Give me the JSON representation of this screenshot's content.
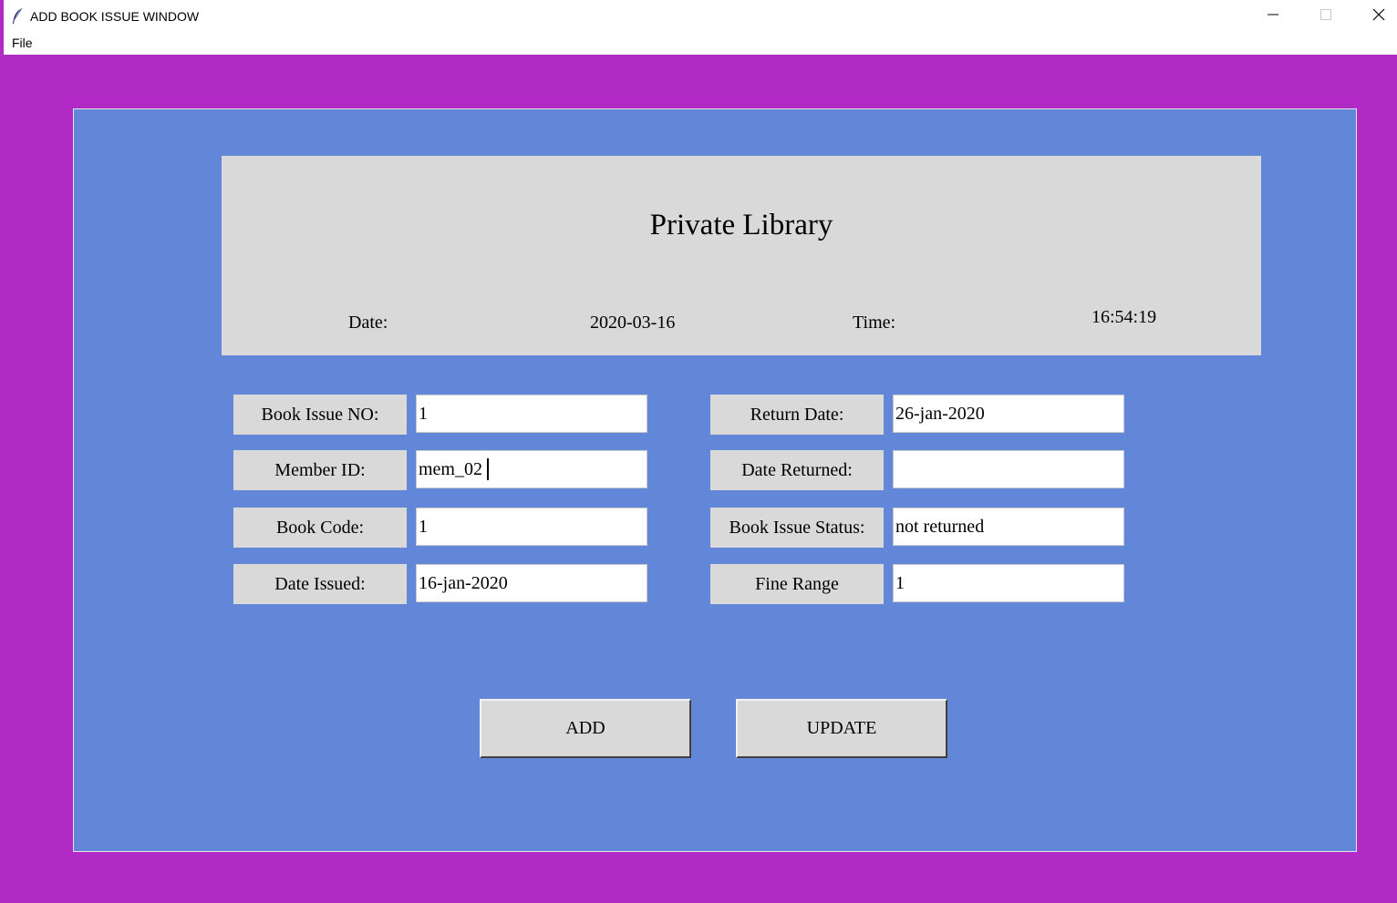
{
  "window": {
    "title": "ADD BOOK ISSUE WINDOW",
    "icon": "feather-icon",
    "controls": [
      "minimize-icon",
      "maximize-icon",
      "close-icon"
    ]
  },
  "menu": {
    "file_label": "File"
  },
  "colors": {
    "outer_bg": "#b12ac5",
    "panel_bg": "#6287d9",
    "header_bg": "#d9d9d9",
    "label_bg": "#d9d9d9",
    "field_bg": "#ffffff"
  },
  "header": {
    "title": "Private Library",
    "date_label": "Date:",
    "date_value": "2020-03-16",
    "time_label": "Time:",
    "time_value": "16:54:19"
  },
  "form": {
    "book_issue_no": {
      "label": "Book Issue NO:",
      "value": "1"
    },
    "member_id": {
      "label": "Member ID:",
      "value": "mem_02"
    },
    "book_code": {
      "label": "Book Code:",
      "value": "1"
    },
    "date_issued": {
      "label": "Date Issued:",
      "value": "16-jan-2020"
    },
    "return_date": {
      "label": "Return Date:",
      "value": "26-jan-2020"
    },
    "date_returned": {
      "label": "Date Returned:",
      "value": ""
    },
    "book_issue_status": {
      "label": "Book Issue Status:",
      "value": "not returned"
    },
    "fine_range": {
      "label": "Fine Range",
      "value": "1"
    }
  },
  "buttons": {
    "add_label": "ADD",
    "update_label": "UPDATE"
  }
}
